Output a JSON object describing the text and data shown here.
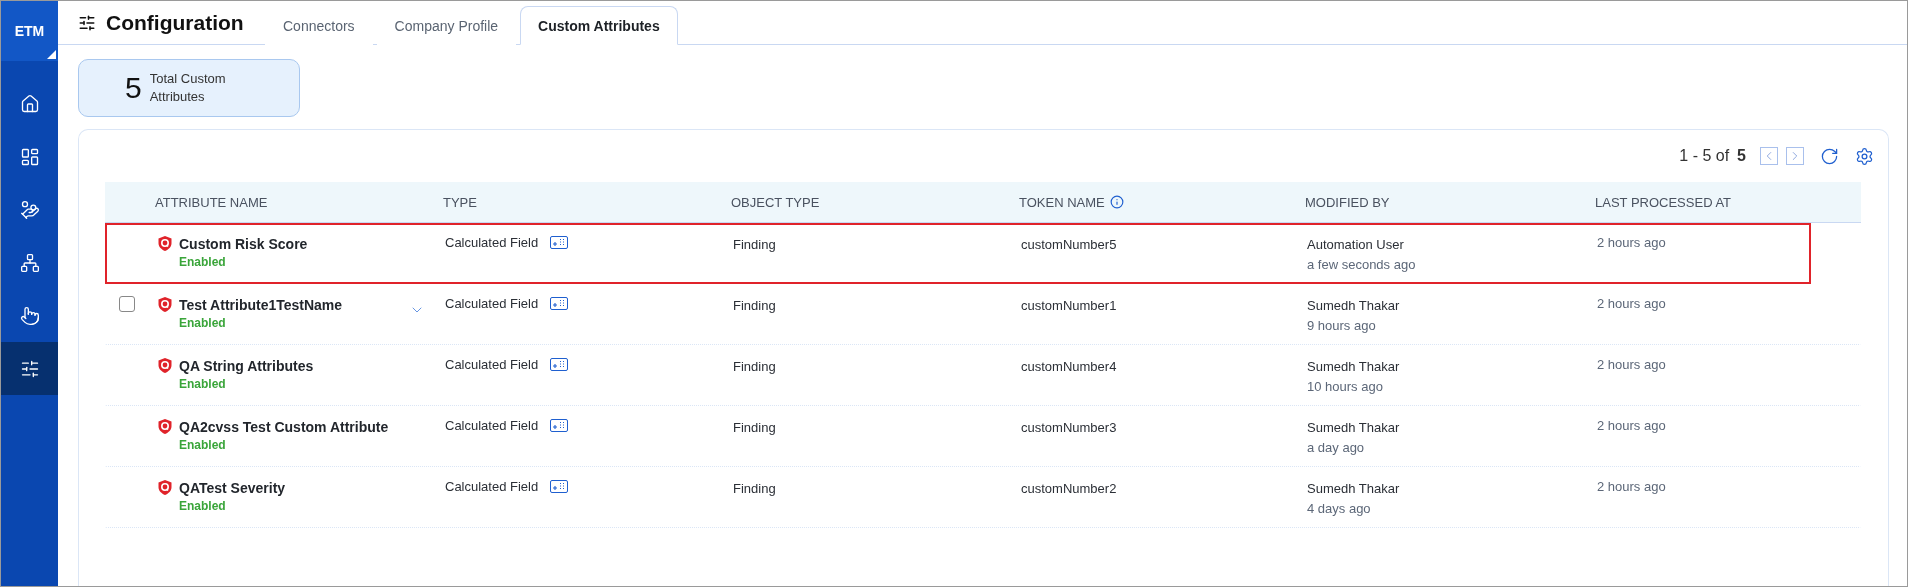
{
  "sidebar": {
    "logo": "ETM",
    "items": [
      {
        "kind": "home",
        "selected": false
      },
      {
        "kind": "dashboard",
        "selected": false
      },
      {
        "kind": "gear",
        "selected": false
      },
      {
        "kind": "network",
        "selected": false
      },
      {
        "kind": "pointer",
        "selected": false
      },
      {
        "kind": "sliders",
        "selected": true
      }
    ]
  },
  "header": {
    "title": "Configuration",
    "tabs": [
      {
        "label": "Connectors",
        "selected": false
      },
      {
        "label": "Company Profile",
        "selected": false
      },
      {
        "label": "Custom Attributes",
        "selected": true
      }
    ]
  },
  "summary": {
    "count": "5",
    "label": "Total Custom Attributes"
  },
  "pagination": {
    "range": "1 - 5 of",
    "total": "5"
  },
  "table": {
    "columns": [
      "ATTRIBUTE NAME",
      "TYPE",
      "OBJECT TYPE",
      "TOKEN NAME",
      "MODIFIED BY",
      "LAST PROCESSED AT"
    ],
    "rows": [
      {
        "name": "Custom Risk Score",
        "status": "Enabled",
        "type": "Calculated Field",
        "object_type": "Finding",
        "token": "customNumber5",
        "modified_by": "Automation User",
        "modified_ago": "a few seconds ago",
        "last_processed": "2 hours ago",
        "highlighted": true,
        "hovered": false,
        "checked": false
      },
      {
        "name": "Test Attribute1TestName",
        "status": "Enabled",
        "type": "Calculated Field",
        "object_type": "Finding",
        "token": "customNumber1",
        "modified_by": "Sumedh Thakar",
        "modified_ago": "9 hours ago",
        "last_processed": "2 hours ago",
        "highlighted": false,
        "hovered": true,
        "checked": false
      },
      {
        "name": "QA String Attributes",
        "status": "Enabled",
        "type": "Calculated Field",
        "object_type": "Finding",
        "token": "customNumber4",
        "modified_by": "Sumedh Thakar",
        "modified_ago": "10 hours ago",
        "last_processed": "2 hours ago",
        "highlighted": false,
        "hovered": false,
        "checked": false
      },
      {
        "name": "QA2cvss Test Custom Attribute",
        "status": "Enabled",
        "type": "Calculated Field",
        "object_type": "Finding",
        "token": "customNumber3",
        "modified_by": "Sumedh Thakar",
        "modified_ago": "a day ago",
        "last_processed": "2 hours ago",
        "highlighted": false,
        "hovered": false,
        "checked": false
      },
      {
        "name": "QATest Severity",
        "status": "Enabled",
        "type": "Calculated Field",
        "object_type": "Finding",
        "token": "customNumber2",
        "modified_by": "Sumedh Thakar",
        "modified_ago": "4 days ago",
        "last_processed": "2 hours ago",
        "highlighted": false,
        "hovered": false,
        "checked": false
      }
    ]
  }
}
